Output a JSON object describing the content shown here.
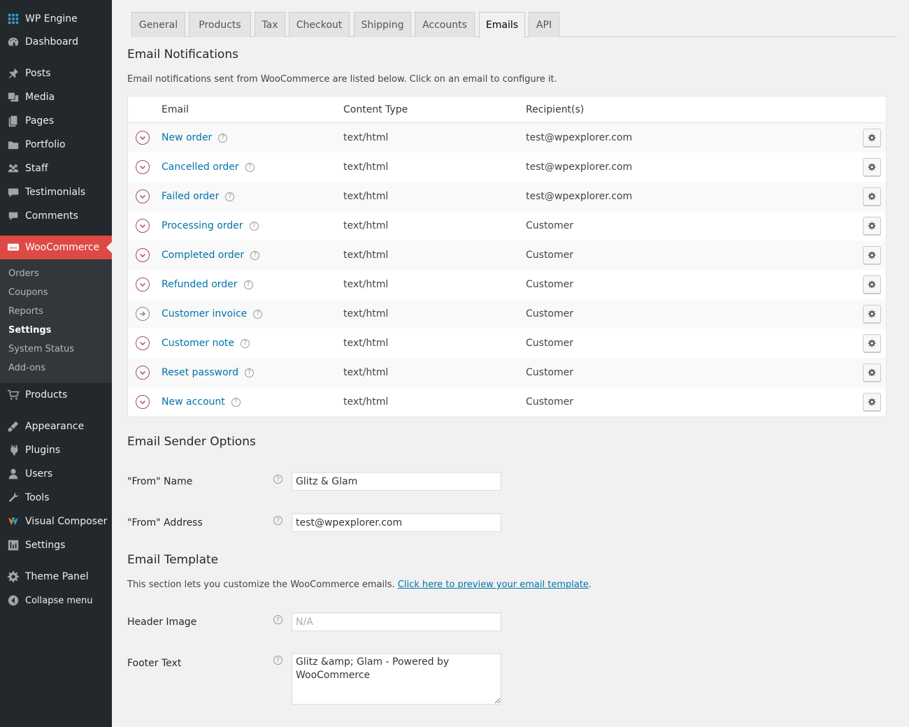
{
  "sidebar": {
    "items": [
      {
        "label": "WP Engine",
        "icon": "wp-engine-icon"
      },
      {
        "label": "Dashboard",
        "icon": "dashboard-icon"
      },
      {
        "label": "Posts",
        "icon": "pin-icon"
      },
      {
        "label": "Media",
        "icon": "media-icon"
      },
      {
        "label": "Pages",
        "icon": "pages-icon"
      },
      {
        "label": "Portfolio",
        "icon": "portfolio-icon"
      },
      {
        "label": "Staff",
        "icon": "staff-icon"
      },
      {
        "label": "Testimonials",
        "icon": "testimonials-icon"
      },
      {
        "label": "Comments",
        "icon": "comments-icon"
      },
      {
        "label": "WooCommerce",
        "icon": "woocommerce-icon"
      },
      {
        "label": "Products",
        "icon": "cart-icon"
      },
      {
        "label": "Appearance",
        "icon": "appearance-icon"
      },
      {
        "label": "Plugins",
        "icon": "plugins-icon"
      },
      {
        "label": "Users",
        "icon": "users-icon"
      },
      {
        "label": "Tools",
        "icon": "tools-icon"
      },
      {
        "label": "Visual Composer",
        "icon": "visual-composer-icon"
      },
      {
        "label": "Settings",
        "icon": "settings-icon"
      },
      {
        "label": "Theme Panel",
        "icon": "gear-icon"
      }
    ],
    "woo_submenu": [
      "Orders",
      "Coupons",
      "Reports",
      "Settings",
      "System Status",
      "Add-ons"
    ],
    "collapse_label": "Collapse menu"
  },
  "tabs": [
    "General",
    "Products",
    "Tax",
    "Checkout",
    "Shipping",
    "Accounts",
    "Emails",
    "API"
  ],
  "active_tab": "Emails",
  "notifications": {
    "title": "Email Notifications",
    "description": "Email notifications sent from WooCommerce are listed below. Click on an email to configure it.",
    "columns": {
      "email": "Email",
      "content_type": "Content Type",
      "recipients": "Recipient(s)"
    },
    "rows": [
      {
        "name": "New order",
        "type": "text/html",
        "recipient": "test@wpexplorer.com",
        "status": "enabled"
      },
      {
        "name": "Cancelled order",
        "type": "text/html",
        "recipient": "test@wpexplorer.com",
        "status": "enabled"
      },
      {
        "name": "Failed order",
        "type": "text/html",
        "recipient": "test@wpexplorer.com",
        "status": "enabled"
      },
      {
        "name": "Processing order",
        "type": "text/html",
        "recipient": "Customer",
        "status": "enabled"
      },
      {
        "name": "Completed order",
        "type": "text/html",
        "recipient": "Customer",
        "status": "enabled"
      },
      {
        "name": "Refunded order",
        "type": "text/html",
        "recipient": "Customer",
        "status": "enabled"
      },
      {
        "name": "Customer invoice",
        "type": "text/html",
        "recipient": "Customer",
        "status": "manual"
      },
      {
        "name": "Customer note",
        "type": "text/html",
        "recipient": "Customer",
        "status": "enabled"
      },
      {
        "name": "Reset password",
        "type": "text/html",
        "recipient": "Customer",
        "status": "enabled"
      },
      {
        "name": "New account",
        "type": "text/html",
        "recipient": "Customer",
        "status": "enabled"
      }
    ]
  },
  "sender": {
    "title": "Email Sender Options",
    "from_name_label": "\"From\" Name",
    "from_name_value": "Glitz & Glam",
    "from_address_label": "\"From\" Address",
    "from_address_value": "test@wpexplorer.com"
  },
  "template": {
    "title": "Email Template",
    "description_prefix": "This section lets you customize the WooCommerce emails. ",
    "preview_link": "Click here to preview your email template",
    "description_suffix": ".",
    "header_image_label": "Header Image",
    "header_image_placeholder": "N/A",
    "footer_text_label": "Footer Text",
    "footer_text_value": "Glitz &amp; Glam - Powered by WooCommerce"
  },
  "colors": {
    "accent": "#dd4a45",
    "link": "#0073aa",
    "sidebar_bg": "#23282d",
    "status": "#a7487a"
  }
}
